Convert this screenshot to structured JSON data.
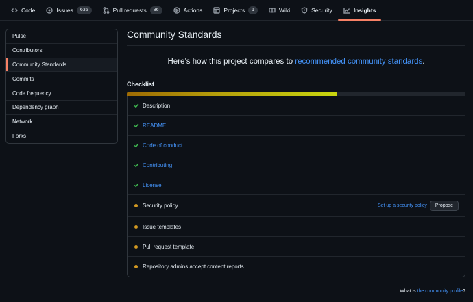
{
  "nav": {
    "tabs": [
      {
        "label": "Code",
        "icon": "code-icon"
      },
      {
        "label": "Issues",
        "icon": "issue-icon",
        "count": "635"
      },
      {
        "label": "Pull requests",
        "icon": "pull-request-icon",
        "count": "36"
      },
      {
        "label": "Actions",
        "icon": "play-icon"
      },
      {
        "label": "Projects",
        "icon": "table-icon",
        "count": "1"
      },
      {
        "label": "Wiki",
        "icon": "book-icon"
      },
      {
        "label": "Security",
        "icon": "shield-icon"
      },
      {
        "label": "Insights",
        "icon": "graph-icon",
        "selected": true
      }
    ]
  },
  "sidebar": {
    "items": [
      {
        "label": "Pulse"
      },
      {
        "label": "Contributors"
      },
      {
        "label": "Community Standards",
        "active": true
      },
      {
        "label": "Commits"
      },
      {
        "label": "Code frequency"
      },
      {
        "label": "Dependency graph"
      },
      {
        "label": "Network"
      },
      {
        "label": "Forks"
      }
    ]
  },
  "main": {
    "title": "Community Standards",
    "lead_prefix": "Here’s how this project compares to ",
    "lead_link": "recommended community standards",
    "lead_suffix": ".",
    "checklist_title": "Checklist",
    "progress": 0.62,
    "items": [
      {
        "label": "Description",
        "status": "done",
        "link": false
      },
      {
        "label": "README",
        "status": "done",
        "link": true
      },
      {
        "label": "Code of conduct",
        "status": "done",
        "link": true
      },
      {
        "label": "Contributing",
        "status": "done",
        "link": true
      },
      {
        "label": "License",
        "status": "done",
        "link": true
      },
      {
        "label": "Security policy",
        "status": "todo",
        "link": false,
        "action_link": "Set up a security policy",
        "button": "Propose"
      },
      {
        "label": "Issue templates",
        "status": "todo",
        "link": false
      },
      {
        "label": "Pull request template",
        "status": "todo",
        "link": false
      },
      {
        "label": "Repository admins accept content reports",
        "status": "todo",
        "link": false
      }
    ]
  },
  "footer": {
    "prefix": "What is ",
    "link": "the community profile",
    "suffix": "?"
  },
  "colors": {
    "accent": "#f78166",
    "link": "#4493f8",
    "success": "#3fb950",
    "pending": "#d29922"
  }
}
